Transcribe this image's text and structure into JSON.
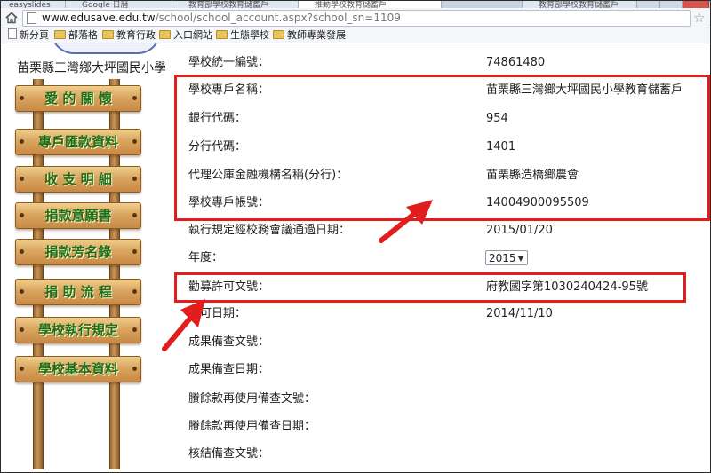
{
  "browser": {
    "tabs": [
      {
        "label": "easyslides"
      },
      {
        "label": "Google 日曆"
      },
      {
        "label": "教育部學校教育儲蓄戶"
      },
      {
        "label": "推動學校教育儲蓄戶"
      },
      {
        "label": "教育部學校教育儲蓄戶"
      }
    ],
    "url_host": "www.edusave.edu.tw",
    "url_path": "/school/school_account.aspx?school_sn=1109",
    "bookmarks": [
      {
        "label": "新分頁",
        "icon": "doc-icon"
      },
      {
        "label": "部落格",
        "icon": "folder-icon"
      },
      {
        "label": "教育行政",
        "icon": "folder-icon"
      },
      {
        "label": "入口網站",
        "icon": "folder-icon"
      },
      {
        "label": "生態學校",
        "icon": "folder-icon"
      },
      {
        "label": "教師專業發展",
        "icon": "folder-icon"
      }
    ]
  },
  "school": {
    "name": "苗栗縣三灣鄉大坪國民小學"
  },
  "menu": {
    "items": [
      {
        "label": "愛 的 關 懷"
      },
      {
        "label": "專戶匯款資料"
      },
      {
        "label": "收 支 明 細"
      },
      {
        "label": "捐款意願書"
      },
      {
        "label": "捐款芳名錄"
      },
      {
        "label": "捐 助 流 程"
      },
      {
        "label": "學校執行規定"
      },
      {
        "label": "學校基本資料"
      }
    ]
  },
  "fields": [
    {
      "label": "學校統一編號：",
      "value": "74861480"
    },
    {
      "label": "學校專戶名稱：",
      "value": "苗栗縣三灣鄉大坪國民小學教育儲蓄戶"
    },
    {
      "label": "銀行代碼：",
      "value": "954"
    },
    {
      "label": "分行代碼：",
      "value": "1401"
    },
    {
      "label": "代理公庫金融機構名稱(分行)：",
      "value": "苗栗縣造橋鄉農會"
    },
    {
      "label": "學校專戶帳號：",
      "value": "14004900095509"
    },
    {
      "label": "執行規定經校務會議通過日期：",
      "value": "2015/01/20"
    },
    {
      "label": "年度：",
      "value": ""
    },
    {
      "label": "勸募許可文號：",
      "value": "府教國字第1030240424-95號"
    },
    {
      "label": "許可日期：",
      "value": "2014/11/10"
    },
    {
      "label": "成果備查文號：",
      "value": ""
    },
    {
      "label": "成果備查日期：",
      "value": ""
    },
    {
      "label": "賸餘款再使用備查文號：",
      "value": ""
    },
    {
      "label": "賸餘款再使用備查日期：",
      "value": ""
    },
    {
      "label": "核結備查文號：",
      "value": ""
    }
  ],
  "year_select": {
    "selected": "2015"
  },
  "annotations": {
    "highlight_color": "#e11d1d"
  }
}
